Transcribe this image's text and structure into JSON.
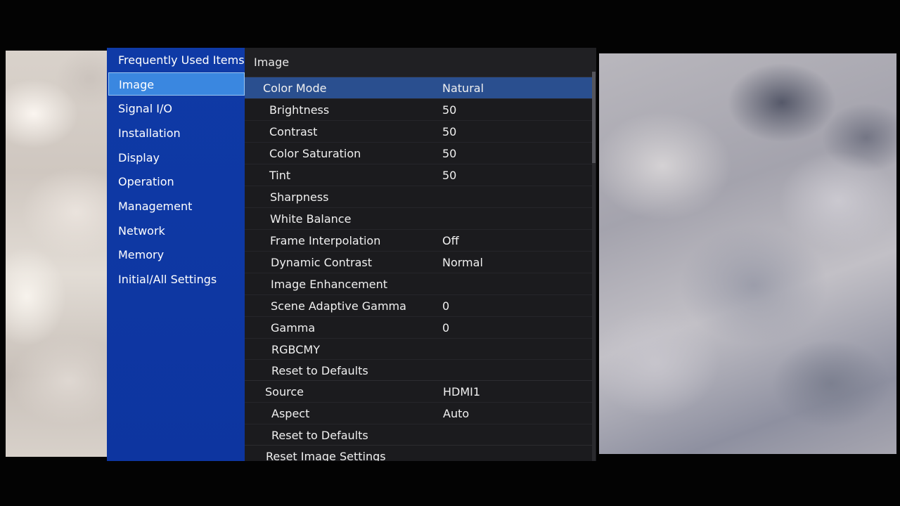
{
  "sidebar": {
    "items": [
      {
        "label": "Frequently Used Items"
      },
      {
        "label": "Image"
      },
      {
        "label": "Signal I/O"
      },
      {
        "label": "Installation"
      },
      {
        "label": "Display"
      },
      {
        "label": "Operation"
      },
      {
        "label": "Management"
      },
      {
        "label": "Network"
      },
      {
        "label": "Memory"
      },
      {
        "label": "Initial/All Settings"
      }
    ],
    "selected": "Image"
  },
  "panel": {
    "title": "Image",
    "rows": [
      {
        "label": "Color Mode",
        "value": "Natural"
      },
      {
        "label": "Brightness",
        "value": "50"
      },
      {
        "label": "Contrast",
        "value": "50"
      },
      {
        "label": "Color Saturation",
        "value": "50"
      },
      {
        "label": "Tint",
        "value": "50"
      },
      {
        "label": "Sharpness",
        "value": ""
      },
      {
        "label": "White Balance",
        "value": ""
      },
      {
        "label": "Frame Interpolation",
        "value": "Off"
      },
      {
        "label": "Dynamic Contrast",
        "value": "Normal"
      },
      {
        "label": "Image Enhancement",
        "value": ""
      },
      {
        "label": "Scene Adaptive Gamma",
        "value": "0"
      },
      {
        "label": "Gamma",
        "value": "0"
      },
      {
        "label": "RGBCMY",
        "value": ""
      },
      {
        "label": "Reset to Defaults",
        "value": ""
      },
      {
        "label": "Source",
        "value": "HDMI1"
      },
      {
        "label": "Aspect",
        "value": "Auto"
      },
      {
        "label": "Reset to Defaults",
        "value": ""
      },
      {
        "label": "Reset Image Settings",
        "value": ""
      }
    ]
  },
  "colors": {
    "sidebar_bg": "#0f3aa6",
    "sidebar_selected": "#3a87e0",
    "panel_bg": "#1b1b1e",
    "row_selected": "#2a4f8f"
  }
}
